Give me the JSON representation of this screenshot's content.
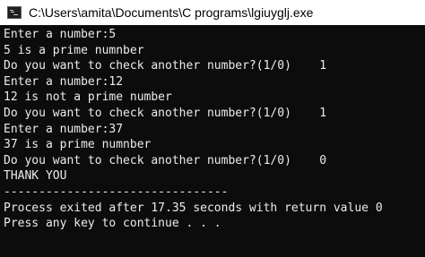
{
  "window": {
    "title": "C:\\Users\\amita\\Documents\\C programs\\lgiuyglj.exe",
    "icon": "console-app-icon"
  },
  "console": {
    "lines": [
      "Enter a number:5",
      "5 is a prime numnber",
      "Do you want to check another number?(1/0)    1",
      "Enter a number:12",
      "12 is not a prime number",
      "Do you want to check another number?(1/0)    1",
      "Enter a number:37",
      "37 is a prime numnber",
      "Do you want to check another number?(1/0)    0",
      "THANK YOU",
      "--------------------------------",
      "Process exited after 17.35 seconds with return value 0",
      "Press any key to continue . . ."
    ]
  }
}
